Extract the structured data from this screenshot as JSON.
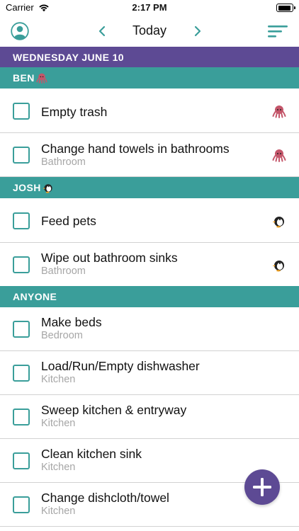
{
  "status_bar": {
    "carrier": "Carrier",
    "time": "2:17 PM"
  },
  "nav": {
    "title": "Today",
    "profile_icon": "person-circle-icon",
    "prev_icon": "chevron-left-icon",
    "next_icon": "chevron-right-icon",
    "menu_icon": "sort-lines-icon"
  },
  "date_header": "WEDNESDAY JUNE 10",
  "sections": {
    "ben": {
      "label": "BEN",
      "emoji": "octopus"
    },
    "josh": {
      "label": "JOSH",
      "emoji": "penguin"
    },
    "anyone": {
      "label": "ANYONE"
    }
  },
  "tasks": [
    {
      "title": "Empty trash",
      "subtitle": "",
      "assignee_emoji": "octopus"
    },
    {
      "title": "Change hand towels in bathrooms",
      "subtitle": "Bathroom",
      "assignee_emoji": "octopus"
    },
    {
      "title": "Feed pets",
      "subtitle": "",
      "assignee_emoji": "penguin"
    },
    {
      "title": "Wipe out bathroom sinks",
      "subtitle": "Bathroom",
      "assignee_emoji": "penguin"
    },
    {
      "title": "Make beds",
      "subtitle": "Bedroom"
    },
    {
      "title": "Load/Run/Empty dishwasher",
      "subtitle": "Kitchen"
    },
    {
      "title": "Sweep kitchen & entryway",
      "subtitle": "Kitchen"
    },
    {
      "title": "Clean kitchen sink",
      "subtitle": "Kitchen"
    },
    {
      "title": "Change dishcloth/towel",
      "subtitle": "Kitchen"
    }
  ],
  "fab": {
    "icon": "plus-icon"
  },
  "colors": {
    "date_header": "#5d4a94",
    "person_header": "#3a9e9a",
    "accent": "#3a9e9a",
    "fab": "#5d4a94",
    "subtitle": "#a6a6a6"
  }
}
